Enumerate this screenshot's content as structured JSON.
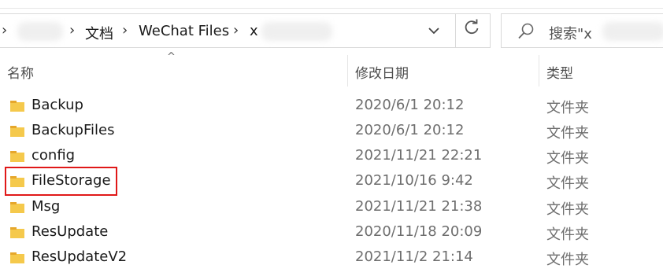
{
  "address": {
    "crumbs": [
      "文档",
      "WeChat Files",
      "x"
    ],
    "dropdown_icon": "chevron-down-icon",
    "refresh_icon": "refresh-icon"
  },
  "search": {
    "placeholder": "搜索\"x"
  },
  "columns": {
    "name": "名称",
    "date": "修改日期",
    "type": "类型"
  },
  "files": [
    {
      "name": "Backup",
      "date": "2020/6/1 20:12",
      "type": "文件夹"
    },
    {
      "name": "BackupFiles",
      "date": "2020/6/1 20:12",
      "type": "文件夹"
    },
    {
      "name": "config",
      "date": "2021/11/21 22:21",
      "type": "文件夹"
    },
    {
      "name": "FileStorage",
      "date": "2021/10/16 9:42",
      "type": "文件夹"
    },
    {
      "name": "Msg",
      "date": "2021/11/21 21:38",
      "type": "文件夹"
    },
    {
      "name": "ResUpdate",
      "date": "2020/11/18 20:09",
      "type": "文件夹"
    },
    {
      "name": "ResUpdateV2",
      "date": "2021/11/2 21:14",
      "type": "文件夹"
    }
  ],
  "highlighted_row": "FileStorage",
  "colors": {
    "folder": "#f5c94c",
    "folder_dark": "#e6a72c",
    "highlight": "#e01818"
  }
}
